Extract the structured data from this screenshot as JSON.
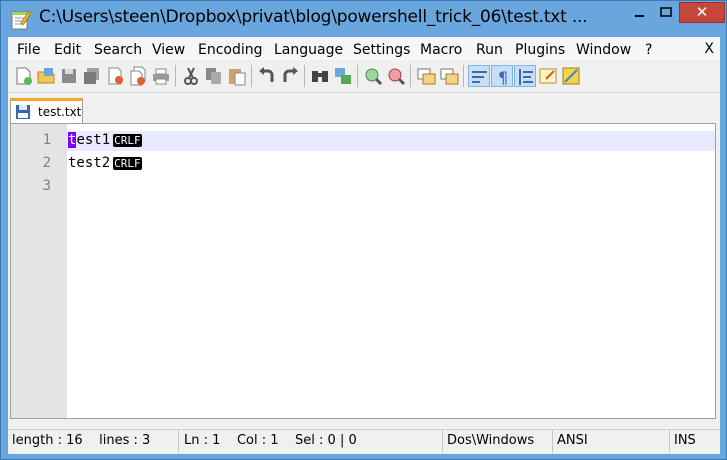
{
  "window": {
    "title": "C:\\Users\\steen\\Dropbox\\privat\\blog\\powershell_trick_06\\test.txt ...",
    "close_glyph": "✕"
  },
  "menu": {
    "items": [
      "File",
      "Edit",
      "Search",
      "View",
      "Encoding",
      "Language",
      "Settings",
      "Macro",
      "Run",
      "Plugins",
      "Window",
      "?"
    ],
    "close": "X"
  },
  "tabs": [
    {
      "label": "test.txt",
      "icon": "save-icon"
    }
  ],
  "editor": {
    "line_numbers": [
      "1",
      "2",
      "3"
    ],
    "lines": [
      {
        "caret_char": "t",
        "text": "est1",
        "eol": "CRLF"
      },
      {
        "caret_char": "",
        "text": "test2",
        "eol": "CRLF"
      },
      {
        "caret_char": "",
        "text": "",
        "eol": ""
      }
    ]
  },
  "status": {
    "length": "length : 16",
    "lines": "lines : 3",
    "ln": "Ln : 1",
    "col": "Col : 1",
    "sel": "Sel : 0 | 0",
    "eol_format": "Dos\\Windows",
    "encoding": "ANSI",
    "mode": "INS"
  },
  "colors": {
    "titlebar": "#6aa6de",
    "close_button": "#c7463c",
    "current_line": "#e8e8ff",
    "caret": "#8000ff",
    "gutter": "#e4e4e4",
    "tab_accent": "#f5a623"
  }
}
